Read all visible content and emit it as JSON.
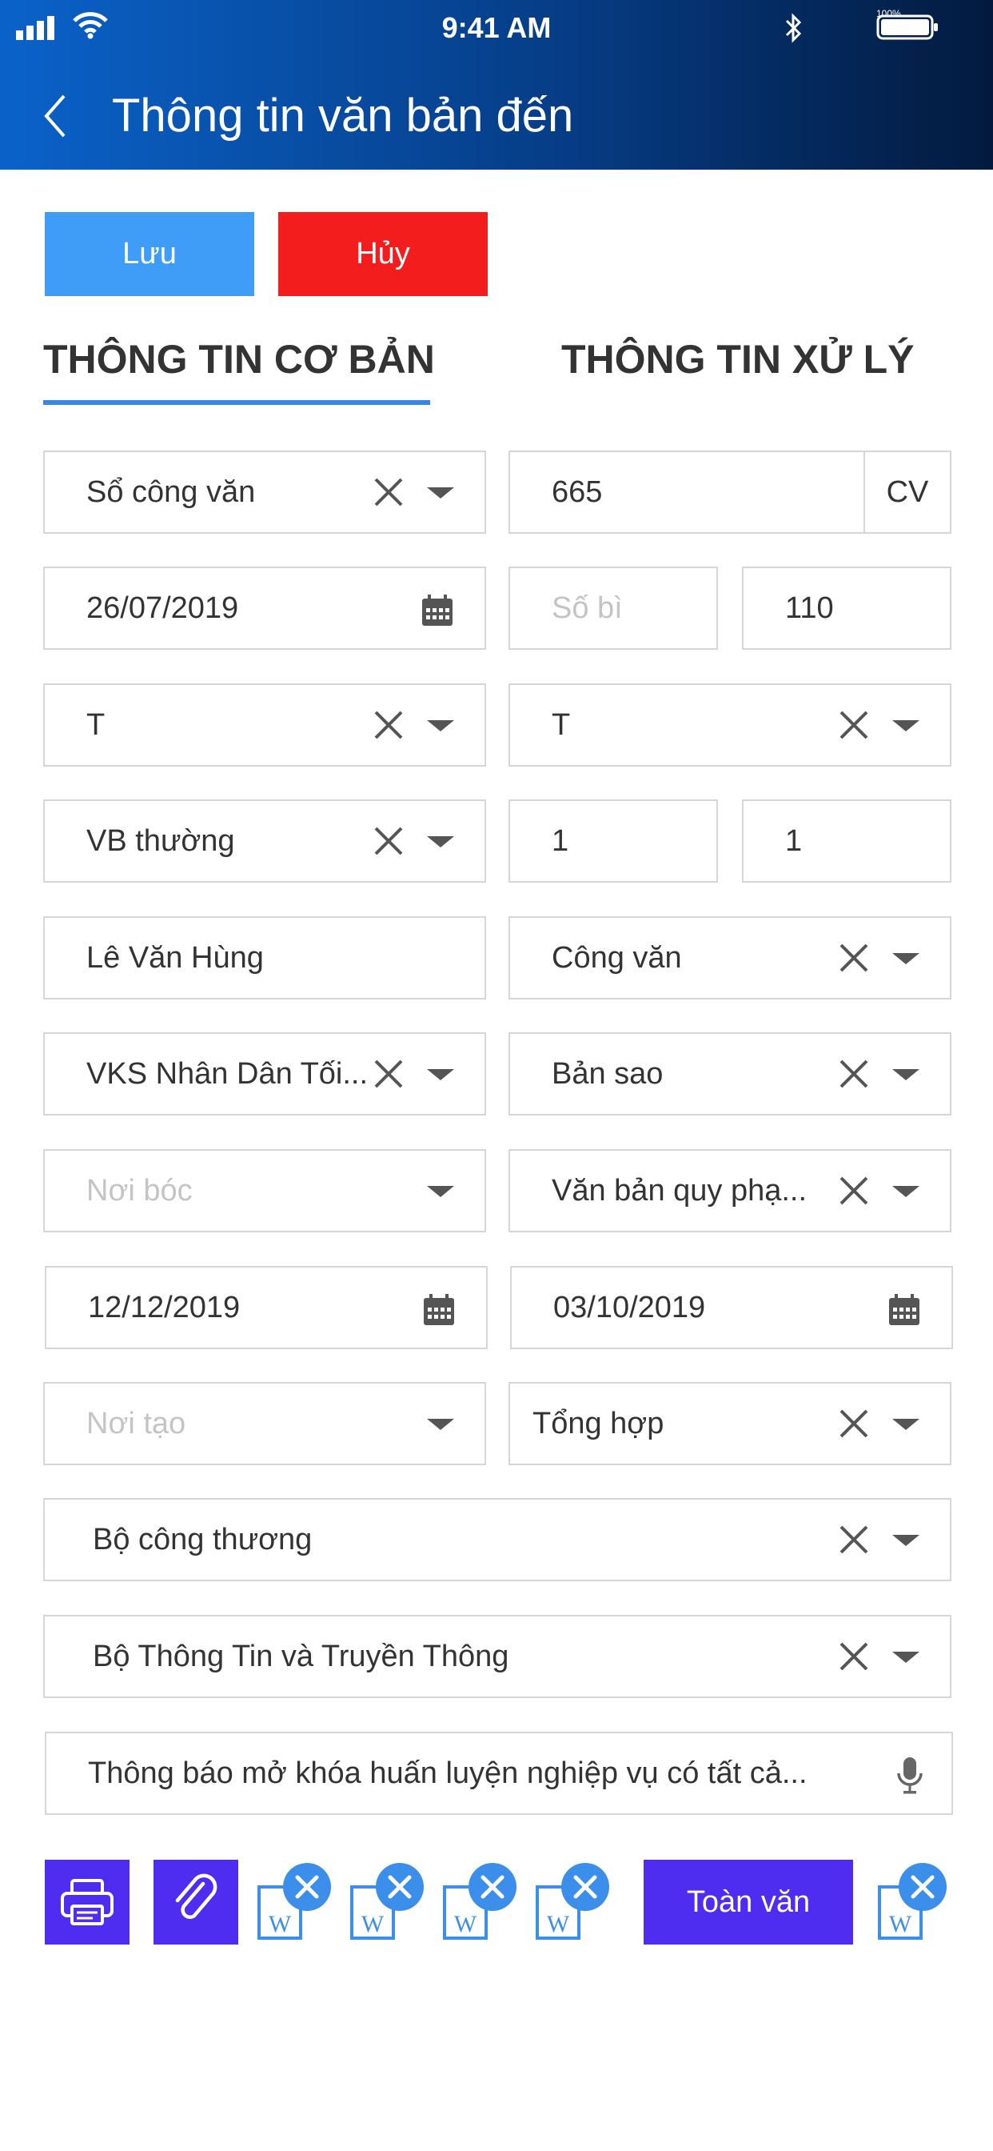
{
  "status_bar": {
    "time": "9:41 AM",
    "battery_percent": "100%"
  },
  "header": {
    "title": "Thông tin văn bản đến"
  },
  "actions": {
    "save_label": "Lưu",
    "cancel_label": "Hủy"
  },
  "tabs": [
    {
      "label": "THÔNG TIN CƠ BẢN",
      "active": true
    },
    {
      "label": "THÔNG TIN XỬ LÝ",
      "active": false
    }
  ],
  "form": {
    "so_cong_van": "Sổ công văn",
    "so_den": "665",
    "so_den_suffix": "CV",
    "ngay_den": "26/07/2019",
    "so_bi_placeholder": "Số bì",
    "so_bi_extra": "110",
    "field_t1": "T",
    "field_t2": "T",
    "loai_vb": "VB thường",
    "num1": "1",
    "num2": "1",
    "nguoi_ky": "Lê Văn Hùng",
    "loai_cong_van": "Công văn",
    "co_quan": "VKS Nhân Dân Tối...",
    "ban_sao": "Bản sao",
    "noi_boc_placeholder": "Nơi bóc",
    "van_ban_quy_pham": "Văn bản quy phạ...",
    "date1": "12/12/2019",
    "date2": "03/10/2019",
    "noi_tao_placeholder": "Nơi tạo",
    "tong_hop": "Tổng hợp",
    "don_vi_1": "Bộ công thương",
    "don_vi_2": "Bộ Thông Tin và Truyền Thông",
    "trich_yeu": "Thông báo mở khóa huấn luyện nghiệp vụ có tất cả..."
  },
  "bottom": {
    "full_text_label": "Toàn văn"
  },
  "colors": {
    "primary": "#3f9cf7",
    "danger": "#f41d1d",
    "purple": "#4e2cf0",
    "tab_underline": "#3a86e0",
    "doc_blue": "#3b8eea"
  }
}
